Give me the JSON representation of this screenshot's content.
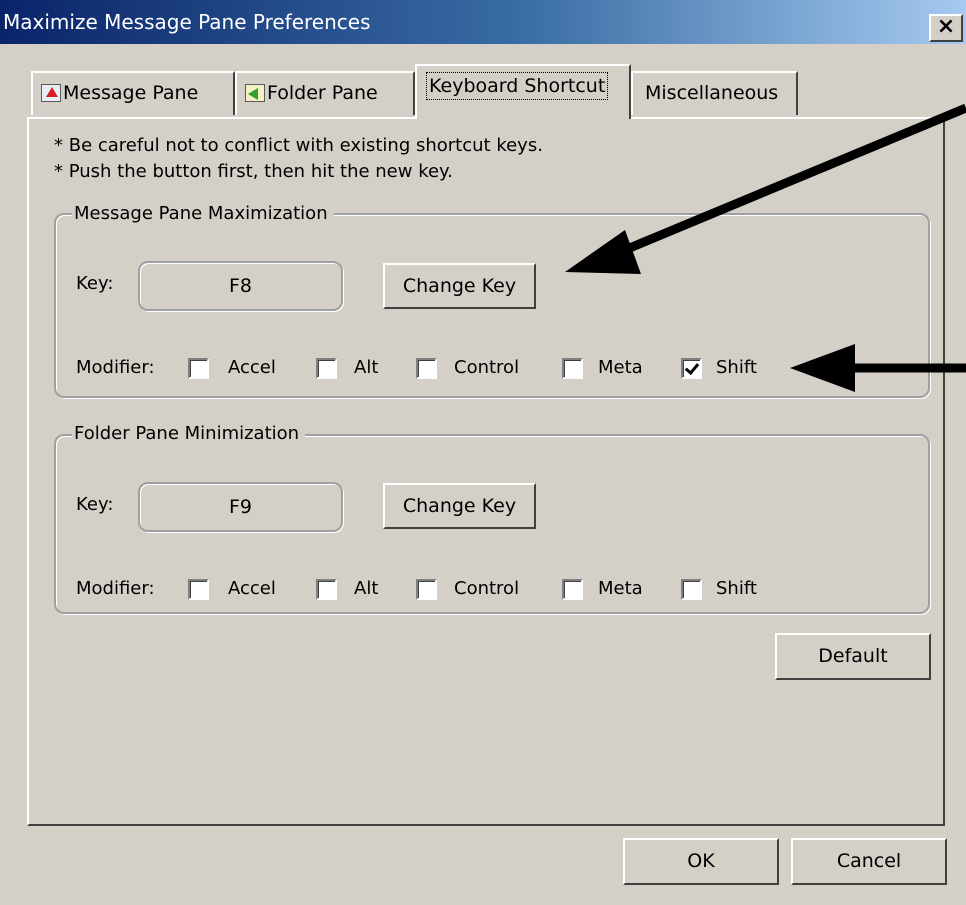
{
  "window": {
    "title": "Maximize Message Pane Preferences",
    "close_glyph": "×"
  },
  "tabs": [
    {
      "label": "Message Pane",
      "icon": "message-pane-icon",
      "active": false
    },
    {
      "label": "Folder Pane",
      "icon": "folder-pane-icon",
      "active": false
    },
    {
      "label": "Keyboard Shortcut",
      "icon": null,
      "active": true
    },
    {
      "label": "Miscellaneous",
      "icon": null,
      "active": false
    }
  ],
  "notes": [
    "* Be careful not to conflict with existing shortcut keys.",
    "* Push the button first, then hit the new key."
  ],
  "groups": [
    {
      "legend": "Message Pane Maximization",
      "key_label": "Key:",
      "key_value": "F8",
      "change_key_label": "Change Key",
      "modifier_label": "Modifier:",
      "modifiers": [
        {
          "label": "Accel",
          "checked": false
        },
        {
          "label": "Alt",
          "checked": false
        },
        {
          "label": "Control",
          "checked": false
        },
        {
          "label": "Meta",
          "checked": false
        },
        {
          "label": "Shift",
          "checked": true
        }
      ]
    },
    {
      "legend": "Folder Pane Minimization",
      "key_label": "Key:",
      "key_value": "F9",
      "change_key_label": "Change Key",
      "modifier_label": "Modifier:",
      "modifiers": [
        {
          "label": "Accel",
          "checked": false
        },
        {
          "label": "Alt",
          "checked": false
        },
        {
          "label": "Control",
          "checked": false
        },
        {
          "label": "Meta",
          "checked": false
        },
        {
          "label": "Shift",
          "checked": false
        }
      ]
    }
  ],
  "buttons": {
    "default": "Default",
    "ok": "OK",
    "cancel": "Cancel"
  },
  "colors": {
    "title_bar_start": "#0a246a",
    "title_bar_end": "#a6caf0",
    "dialog_face": "#d4d0c8",
    "annotation_arrow": "#000000"
  }
}
